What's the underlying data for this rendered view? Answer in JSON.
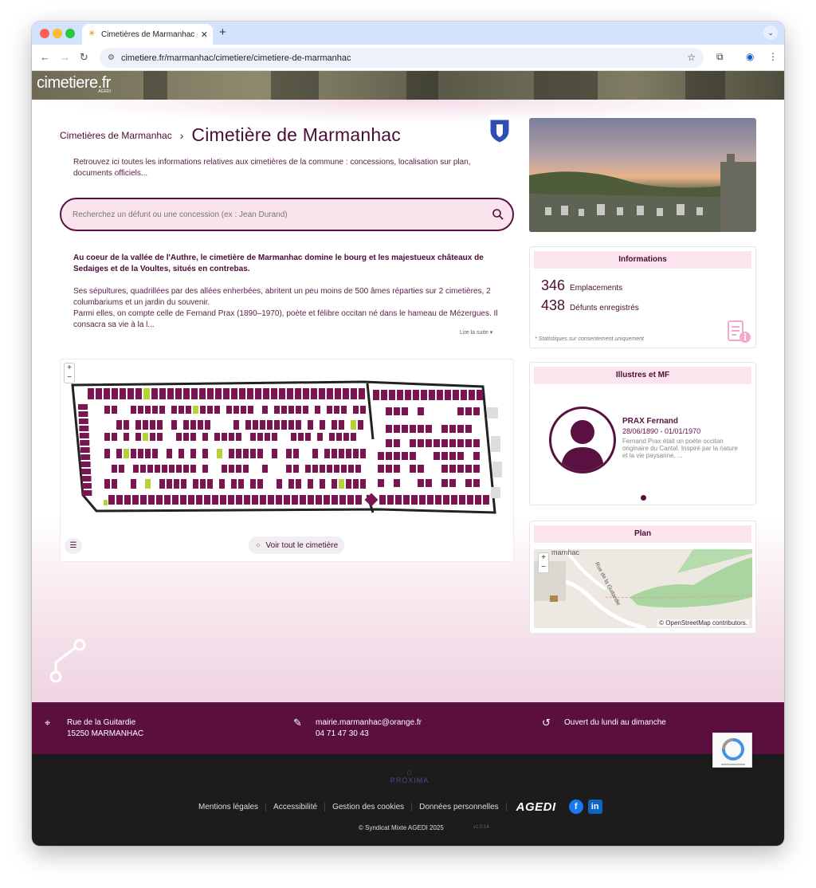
{
  "browser": {
    "tab_title": "Cimetières de Marmanhac - C",
    "url": "cimetiere.fr/marmanhac/cimetiere/cimetiere-de-marmanhac"
  },
  "site": {
    "logo": "cimetiere.fr",
    "logo_sub": "AGEDI"
  },
  "breadcrumb": {
    "parent": "Cimetières de Marmanhac",
    "current": "Cimetière de Marmanhac"
  },
  "intro": "Retrouvez ici toutes les informations relatives aux cimetières de la commune : concessions, localisation sur plan, documents officiels...",
  "search": {
    "placeholder": "Recherchez un défunt ou une concession (ex : Jean Durand)"
  },
  "description": {
    "lead": "Au coeur de la vallée de l'Authre, le cimetière de Marmanhac domine le bourg et les majestueux châteaux de Sedaiges et de la Voultes, situés en contrebas.",
    "p1": "Ses sépultures, quadrillées par des allées enherbées, abritent un peu moins de 500 âmes réparties sur 2 cimetières, 2 columbariums et un jardin du souvenir.",
    "p2": "Parmi elles, on compte celle de Fernand Prax (1890–1970), poète et félibre occitan né dans le hameau de Mézergues. Il consacra sa vie à la l...",
    "read_more": "Lire la suite ▾"
  },
  "plan": {
    "view_all_label": "Voir tout le cimetière"
  },
  "informations": {
    "title": "Informations",
    "stats": [
      {
        "value": "346",
        "label": "Emplacements"
      },
      {
        "value": "438",
        "label": "Défunts enregistrés"
      }
    ],
    "note": "* Statistiques sur consentement uniquement"
  },
  "illustres": {
    "title": "Illustres et MF",
    "name": "PRAX Fernand",
    "dates": "28/06/1890 - 01/01/1970",
    "text": "Fernand Prax était un poète occitan originaire du Cantal. Inspiré par la nature et la vie paysanne, ..."
  },
  "map": {
    "title": "Plan",
    "place": "marnhac",
    "road": "Rue de la Guitardie",
    "attribution": "© OpenStreetMap contributors."
  },
  "footer": {
    "address_line1": "Rue de la Guitardie",
    "address_line2": "15250 MARMANHAC",
    "email": "mairie.marmanhac@orange.fr",
    "phone": "04 71 47 30 43",
    "hours": "Ouvert du lundi au dimanche",
    "proxima": "PROXIMA",
    "links": [
      "Mentions légales",
      "Accessibilité",
      "Gestion des cookies",
      "Données personnelles"
    ],
    "agedi": "AGEDI",
    "copyright": "© Syndicat Mixte AGEDI 2025",
    "version": "v1.0.14"
  },
  "colors": {
    "primary": "#5b0f3f",
    "accent_pink": "#fce4ee",
    "grave": "#7a1552",
    "grave_highlight": "#b5d334"
  }
}
